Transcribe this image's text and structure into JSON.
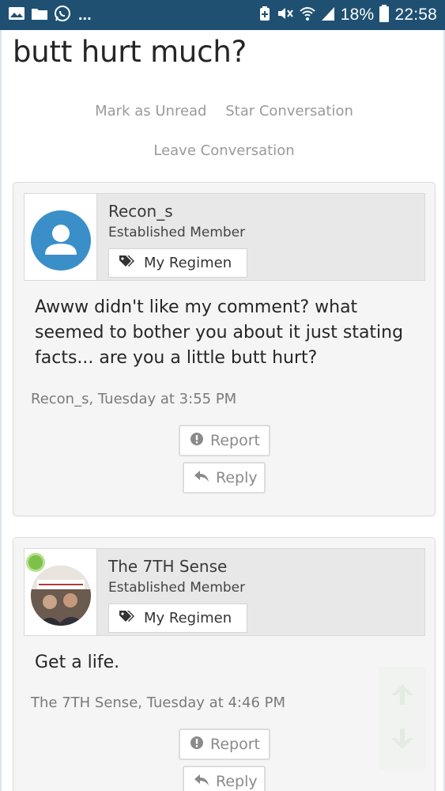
{
  "status_bar": {
    "left_icons": [
      "image-icon",
      "folder-icon",
      "whatsapp-icon"
    ],
    "ellipsis": "...",
    "right_icons": [
      "battery-saver-icon",
      "mute-icon",
      "wifi-icon",
      "signal-icon"
    ],
    "battery": "18%",
    "time": "22:58"
  },
  "page": {
    "title": "butt hurt much?"
  },
  "conversation_actions": {
    "mark_unread": "Mark as Unread",
    "star": "Star Conversation",
    "leave": "Leave Conversation"
  },
  "messages": [
    {
      "username": "Recon_s",
      "role": "Established Member",
      "regimen_label": "My Regimen",
      "line1": "Awww didn't like my comment? what",
      "line2": "seemed to bother you about it just stating",
      "line3": "facts... are you a little butt hurt?",
      "meta": "Recon_s, Tuesday at 3:55 PM",
      "report_label": "Report",
      "reply_label": "Reply",
      "avatar": "default-user-icon"
    },
    {
      "username": "The 7TH Sense",
      "role": "Established Member",
      "regimen_label": "My Regimen",
      "line1": "Get a life.",
      "meta": "The 7TH Sense, Tuesday at 4:46 PM",
      "report_label": "Report",
      "reply_label": "Reply",
      "avatar": "user-photo",
      "online": true
    }
  ],
  "scroll_widget": {
    "up": "arrow-up-icon",
    "down": "arrow-down-icon"
  },
  "colors": {
    "status_bar": "#1f5072",
    "avatar_default": "#3a8fc9",
    "online": "#7ec14a",
    "muted_text": "#9a9a9a"
  }
}
